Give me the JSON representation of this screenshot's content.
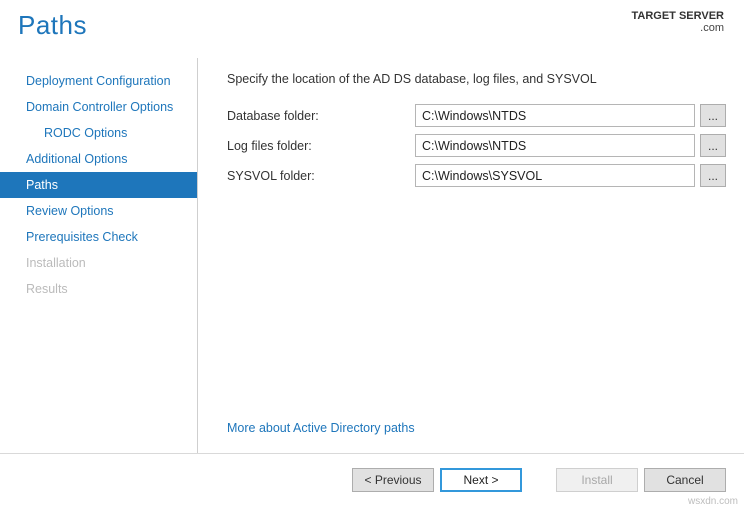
{
  "header": {
    "title": "Paths",
    "target_server_label": "TARGET SERVER",
    "target_server_name": ".com"
  },
  "sidebar": {
    "items": [
      {
        "label": "Deployment Configuration",
        "indent": false,
        "active": false,
        "disabled": false
      },
      {
        "label": "Domain Controller Options",
        "indent": false,
        "active": false,
        "disabled": false
      },
      {
        "label": "RODC Options",
        "indent": true,
        "active": false,
        "disabled": false
      },
      {
        "label": "Additional Options",
        "indent": false,
        "active": false,
        "disabled": false
      },
      {
        "label": "Paths",
        "indent": false,
        "active": true,
        "disabled": false
      },
      {
        "label": "Review Options",
        "indent": false,
        "active": false,
        "disabled": false
      },
      {
        "label": "Prerequisites Check",
        "indent": false,
        "active": false,
        "disabled": false
      },
      {
        "label": "Installation",
        "indent": false,
        "active": false,
        "disabled": true
      },
      {
        "label": "Results",
        "indent": false,
        "active": false,
        "disabled": true
      }
    ]
  },
  "main": {
    "instruction": "Specify the location of the AD DS database, log files, and SYSVOL",
    "fields": [
      {
        "label": "Database folder:",
        "value": "C:\\Windows\\NTDS",
        "name": "database-folder"
      },
      {
        "label": "Log files folder:",
        "value": "C:\\Windows\\NTDS",
        "name": "log-files-folder"
      },
      {
        "label": "SYSVOL folder:",
        "value": "C:\\Windows\\SYSVOL",
        "name": "sysvol-folder"
      }
    ],
    "browse_label": "...",
    "more_link": "More about Active Directory paths"
  },
  "footer": {
    "previous": "< Previous",
    "next": "Next >",
    "install": "Install",
    "cancel": "Cancel"
  },
  "watermark": "wsxdn.com"
}
